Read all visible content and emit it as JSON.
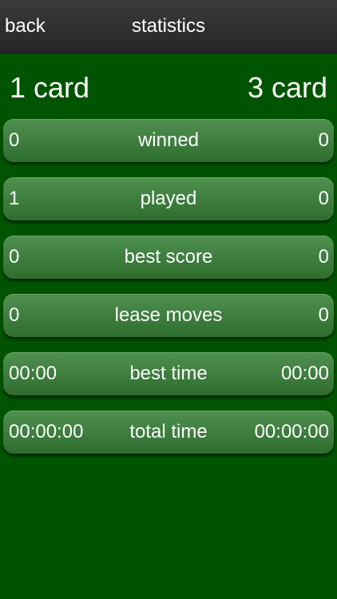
{
  "nav": {
    "back_label": "back",
    "title": "statistics"
  },
  "header": {
    "left": "1 card",
    "right": "3 card"
  },
  "stats": [
    {
      "label": "winned",
      "left": "0",
      "right": "0"
    },
    {
      "label": "played",
      "left": "1",
      "right": "0"
    },
    {
      "label": "best score",
      "left": "0",
      "right": "0"
    },
    {
      "label": "lease moves",
      "left": "0",
      "right": "0"
    },
    {
      "label": "best time",
      "left": "00:00",
      "right": "00:00"
    },
    {
      "label": "total time",
      "left": "00:00:00",
      "right": "00:00:00"
    }
  ],
  "colors": {
    "background": "#005400",
    "nav_bar": "#2e2e2e",
    "row": "#3f7f3f",
    "text": "#ffffff"
  }
}
